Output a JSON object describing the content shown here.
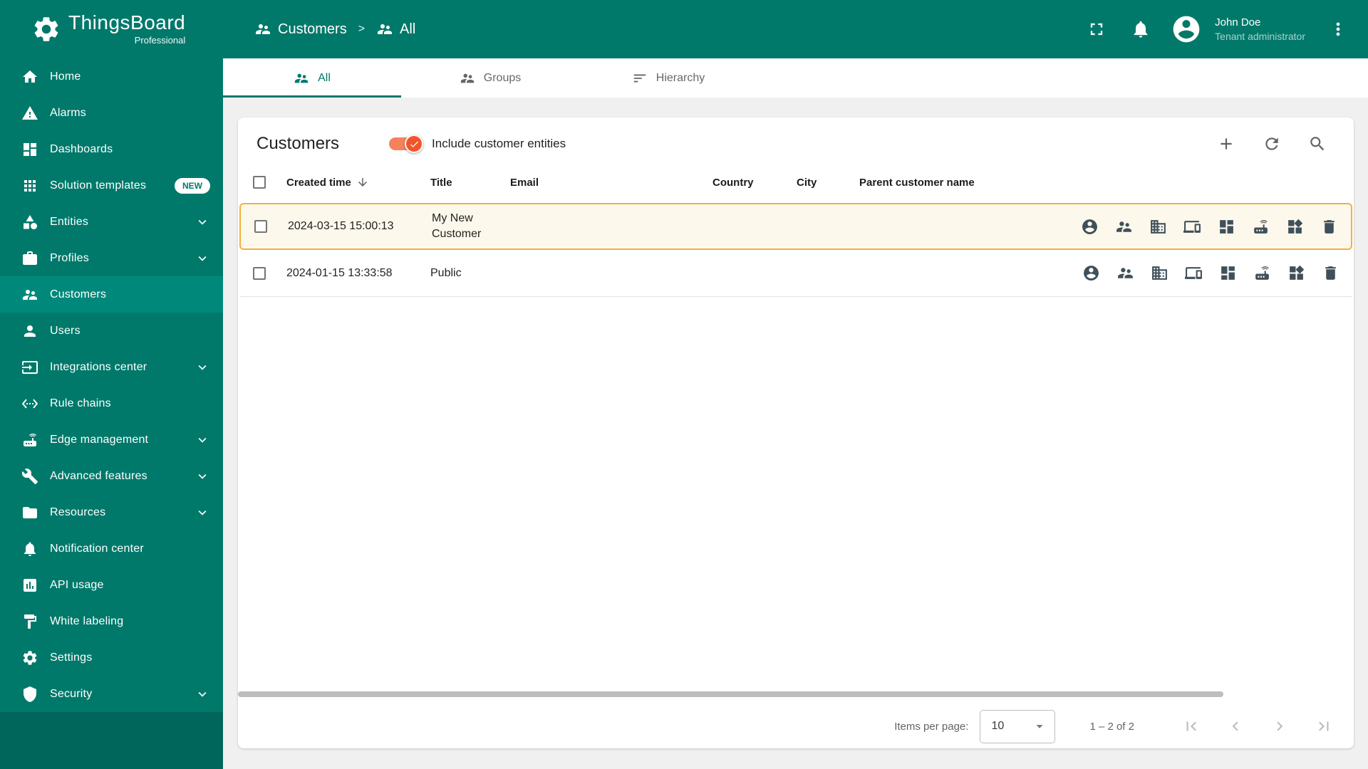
{
  "colors": {
    "primary": "#00796b",
    "primary_selected": "#00897b",
    "sidebar_bottom": "#00655a",
    "toggle_accent": "#f1552a",
    "row_highlight_border": "#f2b13c",
    "row_highlight_bg": "#fdf8ec"
  },
  "app": {
    "name": "ThingsBoard",
    "edition": "Professional"
  },
  "header": {
    "breadcrumb": [
      {
        "label": "Customers",
        "icon": "people-icon"
      },
      {
        "label": "All",
        "icon": "people-icon"
      }
    ],
    "breadcrumb_separator": ">",
    "user": {
      "name": "John Doe",
      "role": "Tenant administrator"
    }
  },
  "sidebar": {
    "items": [
      {
        "label": "Home",
        "icon": "home-icon"
      },
      {
        "label": "Alarms",
        "icon": "warning-icon"
      },
      {
        "label": "Dashboards",
        "icon": "dashboards-icon"
      },
      {
        "label": "Solution templates",
        "icon": "apps-icon",
        "badge": "NEW"
      },
      {
        "label": "Entities",
        "icon": "category-icon",
        "expandable": true
      },
      {
        "label": "Profiles",
        "icon": "badge-icon",
        "expandable": true
      },
      {
        "label": "Customers",
        "icon": "people-icon",
        "selected": true
      },
      {
        "label": "Users",
        "icon": "person-icon"
      },
      {
        "label": "Integrations center",
        "icon": "integrations-icon",
        "expandable": true
      },
      {
        "label": "Rule chains",
        "icon": "rule-chains-icon"
      },
      {
        "label": "Edge management",
        "icon": "router-icon",
        "expandable": true
      },
      {
        "label": "Advanced features",
        "icon": "tools-icon",
        "expandable": true
      },
      {
        "label": "Resources",
        "icon": "folder-icon",
        "expandable": true
      },
      {
        "label": "Notification center",
        "icon": "bell-icon"
      },
      {
        "label": "API usage",
        "icon": "chart-icon"
      },
      {
        "label": "White labeling",
        "icon": "paint-icon"
      },
      {
        "label": "Settings",
        "icon": "gear-icon"
      },
      {
        "label": "Security",
        "icon": "shield-icon",
        "expandable": true
      }
    ]
  },
  "tabs": [
    {
      "label": "All",
      "icon": "people-icon",
      "active": true
    },
    {
      "label": "Groups",
      "icon": "groups-icon",
      "active": false
    },
    {
      "label": "Hierarchy",
      "icon": "hierarchy-icon",
      "active": false
    }
  ],
  "panel": {
    "title": "Customers",
    "toggle": {
      "label": "Include customer entities",
      "checked": true
    }
  },
  "table": {
    "columns": [
      "Created time",
      "Title",
      "Email",
      "Country",
      "City",
      "Parent customer name"
    ],
    "sort": {
      "column": "Created time",
      "direction": "desc"
    },
    "row_actions": [
      "manage-customer-users",
      "manage-customer-user-groups",
      "manage-customer-assets",
      "manage-customer-devices",
      "manage-customer-dashboards",
      "manage-customer-edges",
      "manage-customer-widgets",
      "delete"
    ],
    "rows": [
      {
        "created_time": "2024-03-15 15:00:13",
        "title": "My New Customer",
        "email": "",
        "country": "",
        "city": "",
        "parent_customer_name": "",
        "highlighted": true
      },
      {
        "created_time": "2024-01-15 13:33:58",
        "title": "Public",
        "email": "",
        "country": "",
        "city": "",
        "parent_customer_name": "",
        "highlighted": false
      }
    ]
  },
  "pagination": {
    "items_per_page_label": "Items per page:",
    "items_per_page": "10",
    "range_label": "1 – 2 of 2"
  }
}
